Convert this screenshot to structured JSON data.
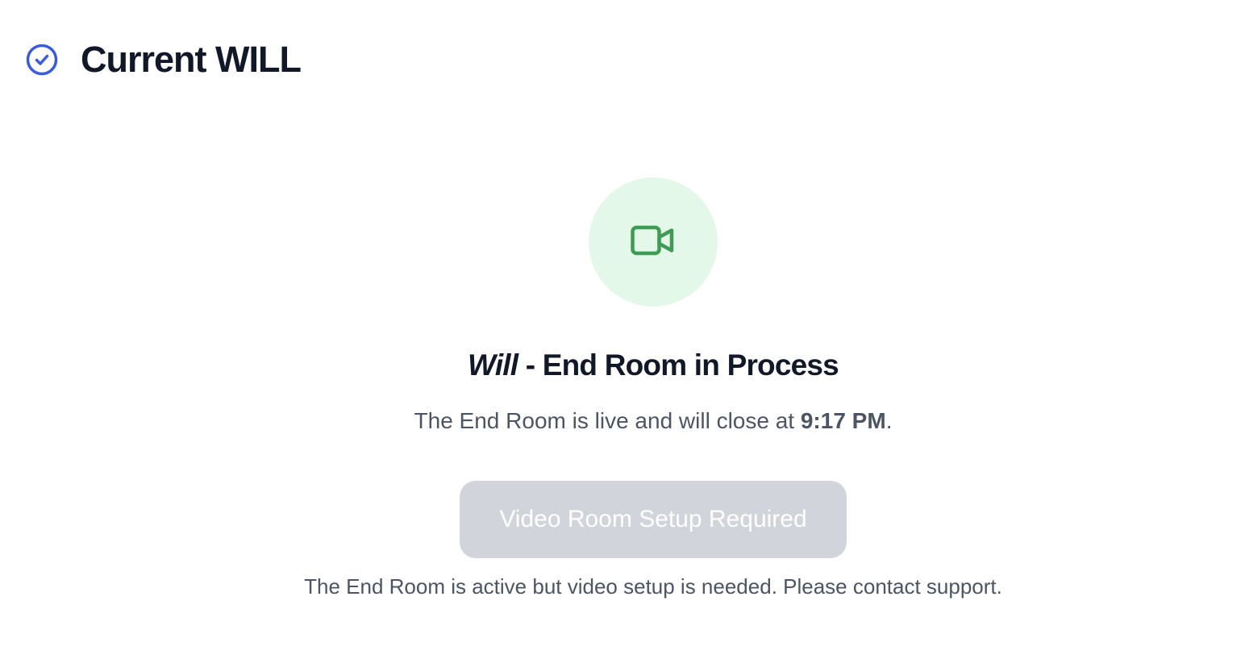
{
  "header": {
    "title": "Current WILL",
    "icon": "check-circle-icon",
    "icon_color": "#3b5bdb"
  },
  "room": {
    "icon": "video-camera-icon",
    "icon_color": "#3f9a55",
    "circle_color": "#e3f8e9",
    "title_italic": "Will",
    "title_rest": " - End Room in Process",
    "status_prefix": "The End Room is live and will close at ",
    "close_time": "9:17 PM",
    "status_suffix": ".",
    "button_label": "Video Room Setup Required",
    "button_disabled": true,
    "help_text": "The End Room is active but video setup is needed. Please contact support."
  }
}
